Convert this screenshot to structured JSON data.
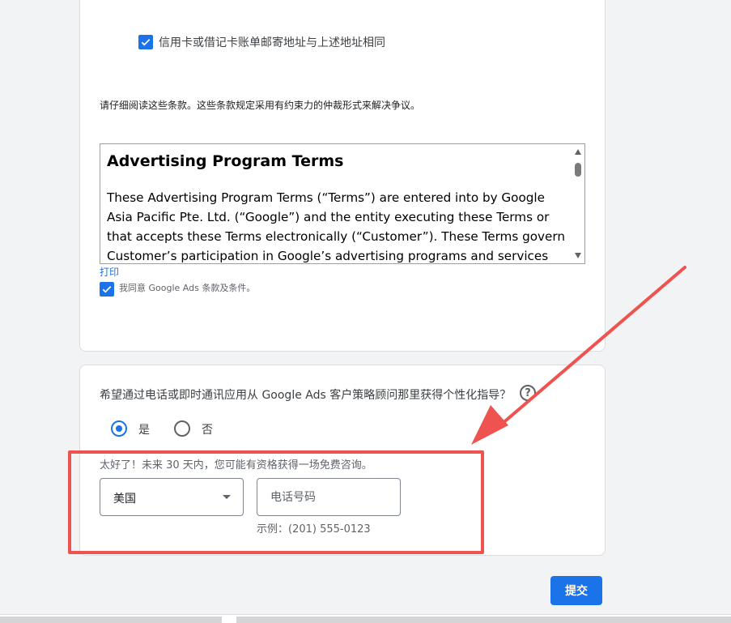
{
  "billing": {
    "same_address_checked": true,
    "same_address_label": "信用卡或借记卡账单邮寄地址与上述地址相同"
  },
  "terms": {
    "notice": "请仔细阅读这些条款。这些条款规定采用有约束力的仲裁形式来解决争议。",
    "title": "Advertising Program Terms",
    "body": "These Advertising Program Terms (“Terms”) are entered into by Google Asia Pacific Pte. Ltd. (“Google”) and the entity executing these Terms or that accepts these Terms electronically (“Customer”). These Terms govern Customer’s participation in Google’s advertising programs and services",
    "print_link": "打印",
    "agree_checked": true,
    "agree_label": "我同意 Google Ads 条款及条件。"
  },
  "consult": {
    "question": "希望通过电话或即时通讯应用从 Google Ads 客户策略顾问那里获得个性化指导？",
    "help_icon": "help-circle-icon",
    "options": [
      {
        "label": "是",
        "selected": true
      },
      {
        "label": "否",
        "selected": false
      }
    ],
    "message": "太好了！未来 30 天内，您可能有资格获得一场免费咨询。",
    "country_value": "美国",
    "phone_placeholder": "电话号码",
    "phone_example": "示例：(201) 555-0123"
  },
  "actions": {
    "submit_label": "提交"
  },
  "colors": {
    "accent": "#1a73e8",
    "annotation": "#ef5350"
  }
}
